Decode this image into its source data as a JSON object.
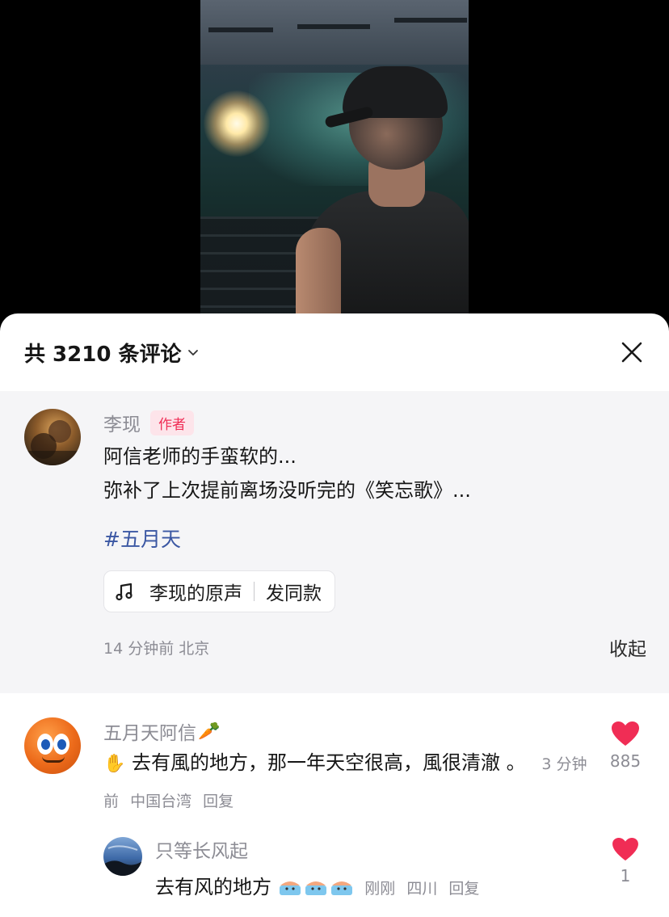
{
  "video": {
    "description_icon": "concert-video-still"
  },
  "sheet": {
    "title": "共 3210 条评论",
    "title_chevron_icon": "chevron-down-icon",
    "close_icon": "close-icon"
  },
  "author_comment": {
    "username": "李现",
    "tag": "作者",
    "lines": [
      "阿信老师的手蛮软的...",
      "弥补了上次提前离场没听完的《笑忘歌》..."
    ],
    "hashtag": "#五月天",
    "sound": {
      "icon": "music-note-icon",
      "label": "李现的原声",
      "action": "发同款"
    },
    "meta": "14 分钟前 北京",
    "collapse_label": "收起"
  },
  "comments": [
    {
      "username": "五月天阿信",
      "username_emoji": "🥕",
      "text_emoji": "✋",
      "text": "去有風的地方，那一年天空很高，風很清澈 。",
      "time": "3 分钟前",
      "location": "中国台湾",
      "reply_label": "回复",
      "likes": "885",
      "like_icon": "heart-icon",
      "liked_color": "#f02d55",
      "replies": [
        {
          "username": "只等长风起",
          "text": "去有风的地方",
          "time": "刚刚",
          "location": "四川",
          "reply_label": "回复",
          "likes": "1",
          "like_icon": "heart-icon"
        }
      ]
    }
  ],
  "colors": {
    "accent_red": "#f02d55",
    "hashtag_blue": "#3b57a3",
    "meta_gray": "#8c8c94",
    "author_block_bg": "#f5f5f7"
  }
}
